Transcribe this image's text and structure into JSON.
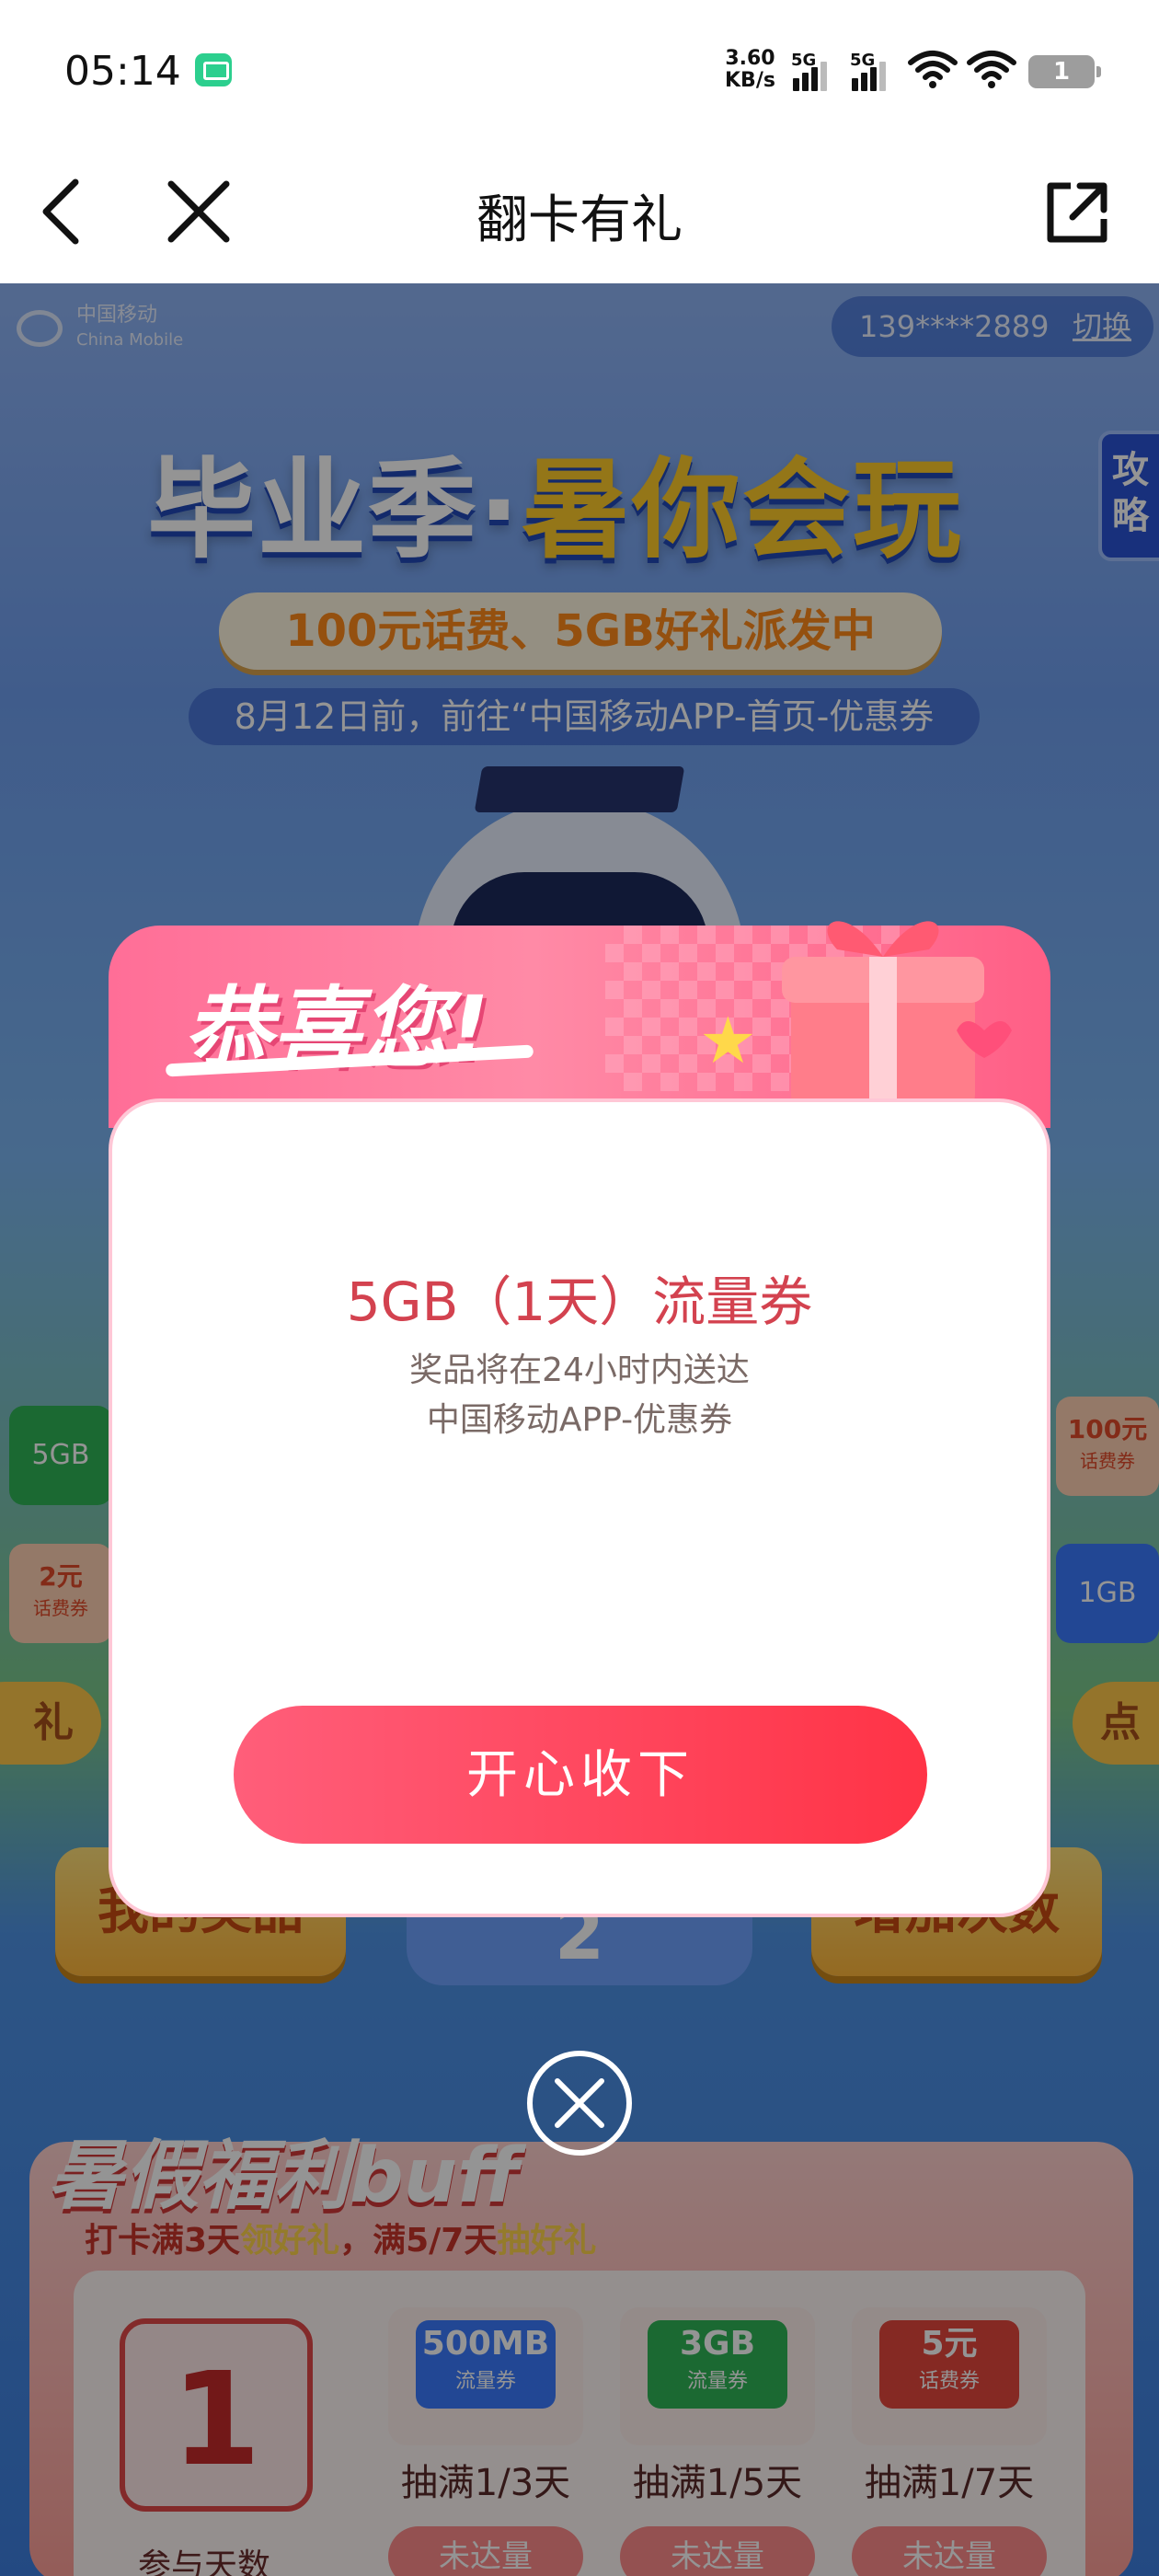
{
  "status_bar": {
    "time": "05:14",
    "net_speed_value": "3.60",
    "net_speed_unit": "KB/s",
    "sim1_label": "5G",
    "sim2_label": "5G",
    "battery": "1"
  },
  "nav": {
    "title": "翻卡有礼"
  },
  "page": {
    "logo_cn": "中国移动",
    "logo_en": "China Mobile",
    "phone": "139****2889",
    "switch_label": "切换",
    "strategy_tab": "攻略",
    "hero_title_part1": "毕业季·",
    "hero_title_part2": "暑你会玩",
    "hero_banner": "100元话费、5GB好礼派发中",
    "hero_note": "8月12日前，前往“中国移动APP-首页-优惠券",
    "side_card_left_1": "5GB",
    "side_card_left_2_big": "2元",
    "side_card_left_2_small": "话费券",
    "side_card_right_1_big": "100元",
    "side_card_right_1_small": "话费券",
    "side_card_right_2": "1GB",
    "side_left_pill": "礼",
    "side_right_pill": "点",
    "my_prizes_button": "我的奖品",
    "add_chances_button": "增加次数",
    "remaining_count": "2",
    "welfare_title": "暑假福利buff",
    "welfare_subtitle_a": "打卡满3天",
    "welfare_subtitle_b": "领好礼",
    "welfare_subtitle_c": "，满5/7天",
    "welfare_subtitle_d": "抽好礼",
    "checkin_days": "1",
    "checkin_label": "参与天数",
    "rewards": [
      {
        "big": "500MB",
        "small": "流量券",
        "req": "抽满1/3天",
        "status": "未达量",
        "color": "#3b7bff"
      },
      {
        "big": "3GB",
        "small": "流量券",
        "req": "抽满1/5天",
        "status": "未达量",
        "color": "#2fb556"
      },
      {
        "big": "5元",
        "small": "话费券",
        "req": "抽满1/7天",
        "status": "未达量",
        "color": "#e6483d"
      }
    ]
  },
  "modal": {
    "heading": "恭喜您!",
    "prize_name": "5GB（1天）流量券",
    "note_line1": "奖品将在24小时内送达",
    "note_line2": "中国移动APP-优惠券",
    "accept_button": "开心收下"
  }
}
